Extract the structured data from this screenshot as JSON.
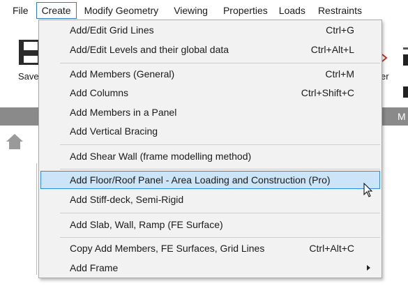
{
  "menubar": {
    "items": [
      {
        "label": "File"
      },
      {
        "label": "Create"
      },
      {
        "label": "Modify Geometry"
      },
      {
        "label": "Viewing"
      },
      {
        "label": "Properties"
      },
      {
        "label": "Loads"
      },
      {
        "label": "Restraints"
      }
    ]
  },
  "ribbon": {
    "save_label": "Save",
    "right_label": "er",
    "strip_text": "M"
  },
  "create_menu": {
    "items": [
      {
        "label": "Add/Edit Grid Lines",
        "shortcut": "Ctrl+G"
      },
      {
        "label": "Add/Edit Levels and their global data",
        "shortcut": "Ctrl+Alt+L"
      },
      {
        "label": "Add Members (General)",
        "shortcut": "Ctrl+M"
      },
      {
        "label": "Add Columns",
        "shortcut": "Ctrl+Shift+C"
      },
      {
        "label": "Add Members in a Panel",
        "shortcut": ""
      },
      {
        "label": "Add Vertical Bracing",
        "shortcut": ""
      },
      {
        "label": "Add Shear Wall (frame modelling method)",
        "shortcut": ""
      },
      {
        "label": "Add Floor/Roof Panel - Area Loading and Construction (Pro)",
        "shortcut": ""
      },
      {
        "label": "Add Stiff-deck, Semi-Rigid",
        "shortcut": ""
      },
      {
        "label": "Add Slab, Wall, Ramp (FE Surface)",
        "shortcut": ""
      },
      {
        "label": "Copy Add Members, FE Surfaces, Grid Lines",
        "shortcut": "Ctrl+Alt+C"
      },
      {
        "label": "Add Frame",
        "shortcut": ""
      }
    ],
    "hovered_item": "Add Floor/Roof Panel - Area Loading and Construction (Pro)"
  },
  "colors": {
    "menu_active_border": "#2b7ad3",
    "hover_fill": "#cce4f7",
    "hover_border": "#2f8ad9",
    "strip": "#8a8a8a"
  }
}
